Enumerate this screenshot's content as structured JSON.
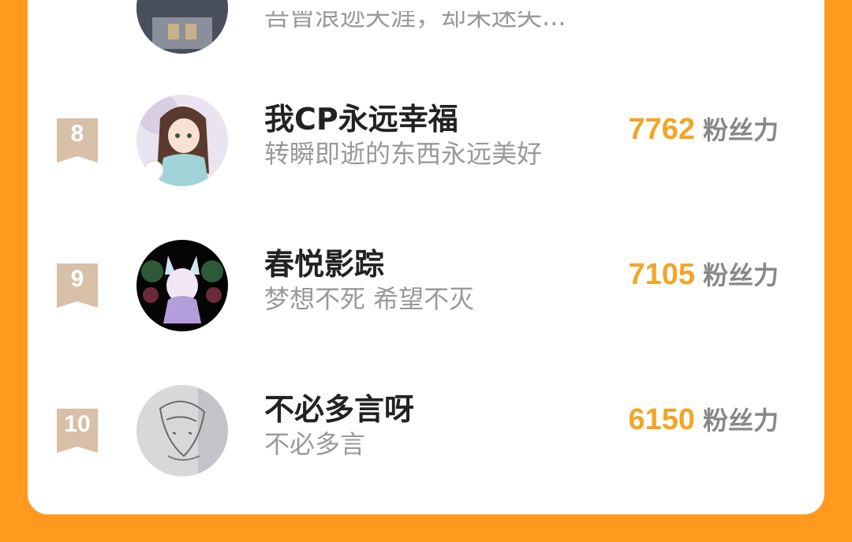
{
  "partial_row": {
    "signature": "吾曾浪迹天涯，却未迷失..."
  },
  "rows": [
    {
      "rank": "8",
      "name": "我CP永远幸福",
      "signature": "转瞬即逝的东西永远美好",
      "score": "7762",
      "score_unit": "粉丝力"
    },
    {
      "rank": "9",
      "name": "春悦影踪",
      "signature": "梦想不死 希望不灭",
      "score": "7105",
      "score_unit": "粉丝力"
    },
    {
      "rank": "10",
      "name": "不必多言呀",
      "signature": "不必多言",
      "score": "6150",
      "score_unit": "粉丝力"
    }
  ],
  "colors": {
    "background": "#FF9A1F",
    "card": "#FFFFFF",
    "score": "#F2A526",
    "rank_badge": "#D7BFA8",
    "name": "#222222",
    "signature": "#999999"
  }
}
